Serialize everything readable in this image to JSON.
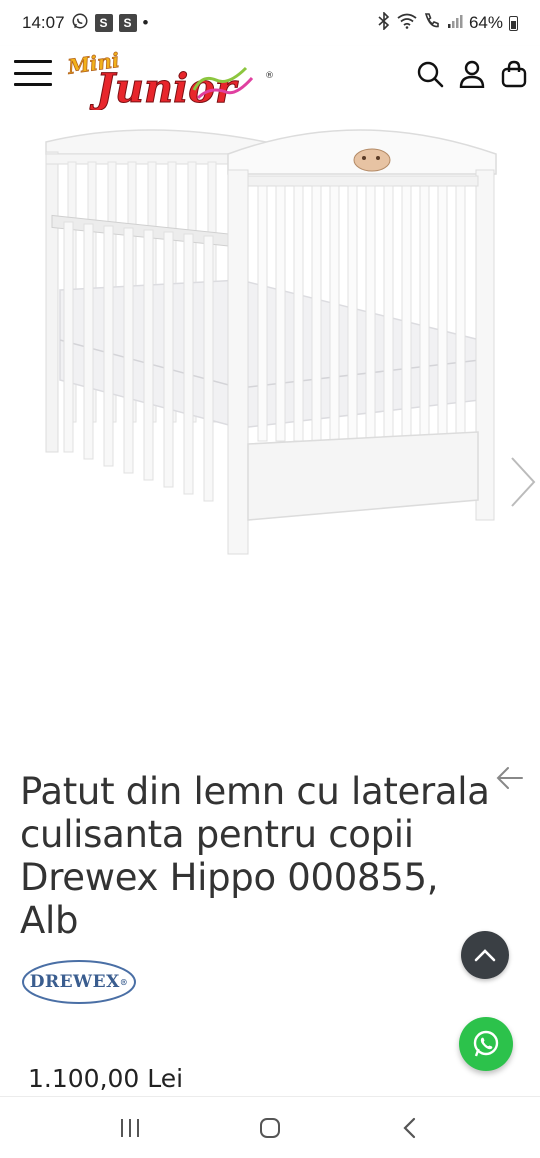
{
  "status_bar": {
    "time": "14:07",
    "badge_1": "S",
    "badge_2": "S",
    "dot": "•",
    "battery_text": "64%",
    "icons": [
      "whatsapp-icon",
      "bluetooth-icon",
      "wifi-icon",
      "call-icon",
      "signal-icon",
      "battery-icon"
    ]
  },
  "header": {
    "logo_text_top": "Mini",
    "logo_text_main": "Junior",
    "logo_registered": "®",
    "icons": [
      "menu-icon",
      "search-icon",
      "user-icon",
      "cart-icon"
    ]
  },
  "product": {
    "title": "Patut din lemn cu laterala culisanta pentru copii Drewex Hippo 000855, Alb",
    "brand": "DREWEX",
    "brand_registered": "®",
    "price": "1.100,00 Lei",
    "image_subject": "crib-image"
  },
  "nav_bar": {
    "icons": [
      "recent-apps-icon",
      "home-icon",
      "back-icon"
    ]
  },
  "colors": {
    "accent_dark": "#3a3f44",
    "whatsapp_green": "#2cc24b",
    "brand_blue": "#3a5d8f"
  }
}
